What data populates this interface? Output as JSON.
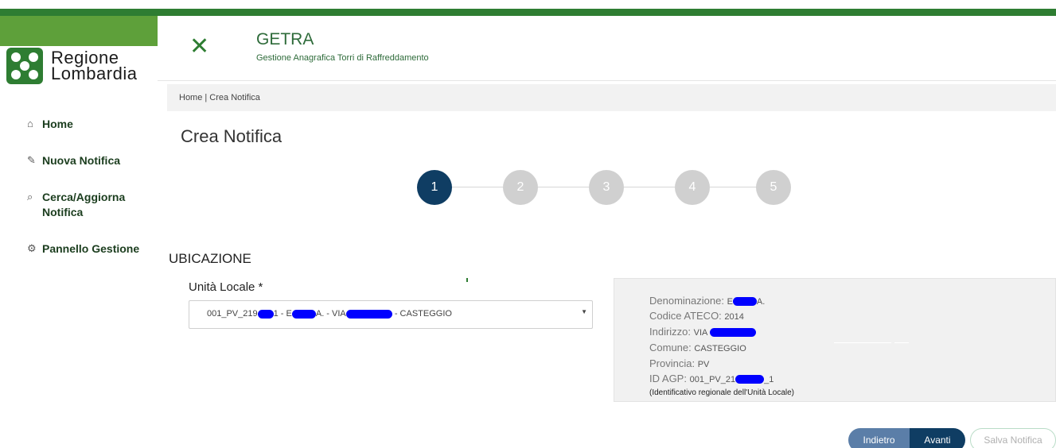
{
  "brand": {
    "line1": "Regione",
    "line2": "Lombardia"
  },
  "header": {
    "close_icon": "close-icon",
    "title": "GETRA",
    "subtitle": "Gestione Anagrafica Torri di Raffreddamento"
  },
  "sidebar": {
    "items": [
      {
        "icon": "home-icon",
        "glyph": "⌂",
        "label": "Home"
      },
      {
        "icon": "edit-icon",
        "glyph": "✎",
        "label": "Nuova Notifica"
      },
      {
        "icon": "search-icon",
        "glyph": "⌕",
        "label": "Cerca/Aggiorna Notifica"
      },
      {
        "icon": "gear-icon",
        "glyph": "⚙",
        "label": "Pannello Gestione"
      }
    ]
  },
  "breadcrumb": "Home | Crea Notifica",
  "page_title": "Crea Notifica",
  "stepper": {
    "steps": [
      "1",
      "2",
      "3",
      "4",
      "5"
    ],
    "active": 1
  },
  "section": {
    "title": "UBICAZIONE"
  },
  "unit_select": {
    "label": "Unità Locale *",
    "value_parts": [
      "001_PV_219",
      "1 - E",
      "A. - VIA",
      "- CASTEGGIO"
    ]
  },
  "details": {
    "denominazione_label": "Denominazione:",
    "denominazione_a": "E",
    "denominazione_b": "A.",
    "ateco_label": "Codice ATECO:",
    "ateco_value": "2014",
    "indirizzo_label": "Indirizzo:",
    "indirizzo_value": "VIA",
    "comune_label": "Comune:",
    "comune_value": "CASTEGGIO",
    "provincia_label": "Provincia:",
    "provincia_value": "PV",
    "idagp_label": "ID AGP:",
    "idagp_a": "001_PV_21",
    "idagp_b": "_1",
    "note": "(Identificativo regionale dell'Unità Locale)"
  },
  "buttons": {
    "back": "Indietro",
    "next": "Avanti",
    "save": "Salva Notifica"
  },
  "colors": {
    "brand_green": "#2e7d32",
    "active_step": "#0f3d63",
    "inactive_step": "#d0d0d0",
    "redaction": "#0000ff"
  }
}
